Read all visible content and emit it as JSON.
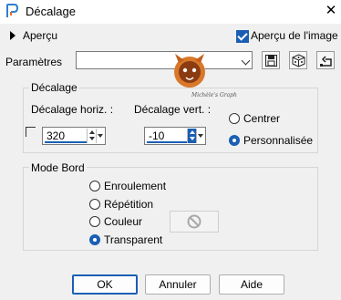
{
  "window": {
    "title": "Décalage",
    "close_glyph": "✕"
  },
  "preview": {
    "label": "Aperçu",
    "preview_on_image_label": "Aperçu de l'image",
    "preview_on_image_checked": true
  },
  "params": {
    "label": "Paramètres",
    "preset_value": "",
    "watermark_text": "Michèle's Graph"
  },
  "offset": {
    "group_label": "Décalage",
    "horiz_label": "Décalage horiz. :",
    "horiz_value": "320",
    "vert_label": "Décalage vert. :",
    "vert_value": "-10",
    "mode_center_label": "Centrer",
    "mode_custom_label": "Personnalisée",
    "selected_mode": "custom"
  },
  "edge_mode": {
    "group_label": "Mode Bord",
    "options": [
      "Enroulement",
      "Répétition",
      "Couleur",
      "Transparent"
    ],
    "selected": "Transparent",
    "color_state": "disabled"
  },
  "buttons": {
    "ok": "OK",
    "cancel": "Annuler",
    "help": "Aide"
  },
  "colors": {
    "accent": "#1a5fb4",
    "background": "#f0f0f0"
  }
}
